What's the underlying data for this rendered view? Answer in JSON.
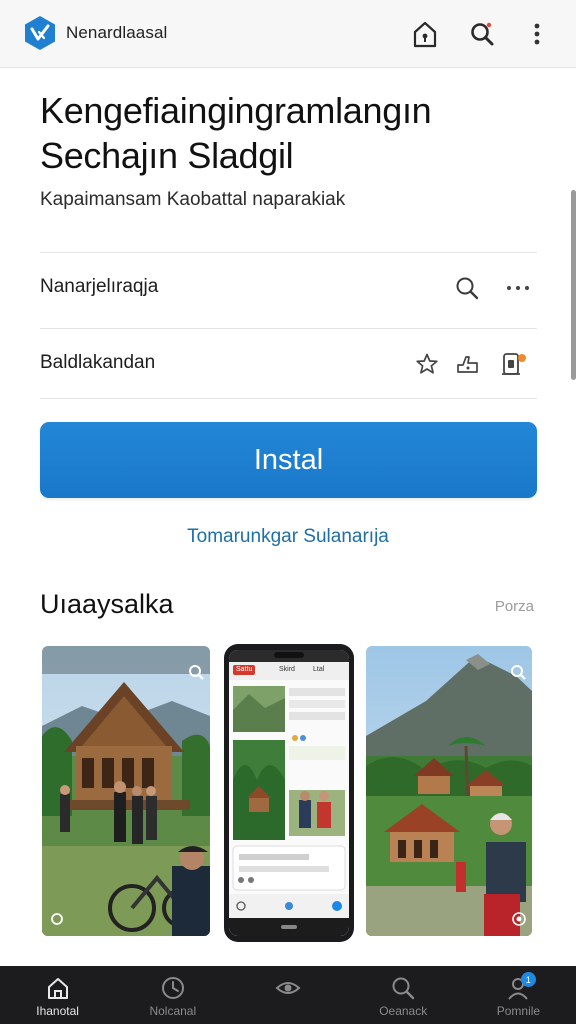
{
  "app_bar": {
    "brand": "Nenardlaasal",
    "icons": [
      "home-lock-icon",
      "search-icon",
      "more-vert-icon"
    ],
    "accent": "#1f7fd0"
  },
  "header": {
    "title": "Kengefiaingingramlangın Sechajın Sladgil",
    "subtitle": "Kapaimansam Kaobattal naparakiak"
  },
  "rows": [
    {
      "label": "Nanarjelıraqja",
      "icons": [
        "search-icon",
        "more-horiz-icon"
      ]
    },
    {
      "label": "Baldlakandan",
      "icons": [
        "star-icon",
        "share-icon",
        "badge-icon"
      ]
    }
  ],
  "install_button": {
    "label": "Instal",
    "color": "#1a78c9"
  },
  "secondary_link": "Tomarunkgar Sulanarıja",
  "screenshots_section": {
    "title": "Uıaaysalka",
    "more": "Porza",
    "phone_screen_texts": [
      "Sattu",
      "Skird",
      "Ltal"
    ]
  },
  "bottom_nav": {
    "items": [
      {
        "label": "Ihanotal",
        "icon": "home-icon",
        "active": true
      },
      {
        "label": "Nolcanal",
        "icon": "clock-icon",
        "active": false
      },
      {
        "label": "",
        "icon": "eye-icon",
        "active": false
      },
      {
        "label": "Oeanack",
        "icon": "search-icon",
        "active": false
      },
      {
        "label": "Pomnile",
        "icon": "profile-icon",
        "active": false,
        "badge": "1"
      }
    ]
  }
}
